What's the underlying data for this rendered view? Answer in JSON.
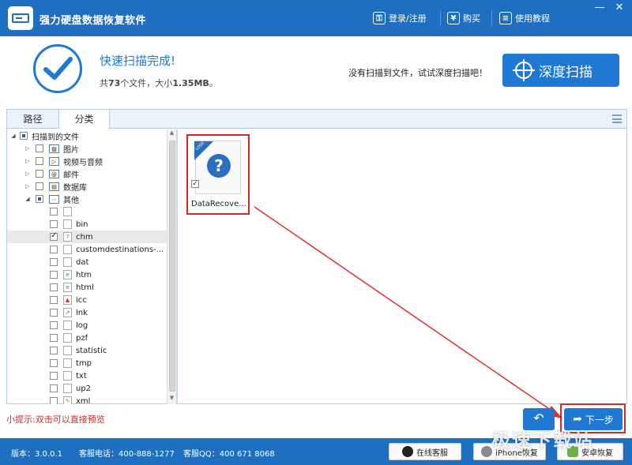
{
  "app": {
    "title": "强力硬盘数据恢复软件",
    "window_controls": {
      "minimize": "—",
      "close": "✕"
    }
  },
  "header_links": [
    {
      "label": "登录/注册",
      "icon": "login-icon"
    },
    {
      "label": "购买",
      "icon": "yen-icon"
    },
    {
      "label": "使用教程",
      "icon": "tutorial-icon"
    }
  ],
  "status": {
    "title": "快速扫描完成!",
    "summary_prefix": "共",
    "file_count": "73",
    "summary_middle": "个文件，大小",
    "total_size": "1.35MB",
    "summary_suffix": "。",
    "deep_hint": "没有扫描到文件，试试深度扫描吧！",
    "deep_scan_label": "深度扫描"
  },
  "tabs": [
    {
      "label": "路径",
      "active": false
    },
    {
      "label": "分类",
      "active": true
    }
  ],
  "tree": {
    "root": {
      "label": "扫描到的文件",
      "state": "partial"
    },
    "categories": [
      {
        "label": "图片",
        "icon": "image-icon",
        "state": "unchecked"
      },
      {
        "label": "视频与音频",
        "icon": "video-icon",
        "state": "unchecked"
      },
      {
        "label": "邮件",
        "icon": "mail-icon",
        "state": "unchecked"
      },
      {
        "label": "数据库",
        "icon": "database-icon",
        "state": "unchecked"
      },
      {
        "label": "其他",
        "icon": "other-icon",
        "state": "partial"
      }
    ],
    "types": [
      {
        "label": "",
        "state": "unchecked"
      },
      {
        "label": "bin",
        "state": "unchecked"
      },
      {
        "label": "chm",
        "state": "checked",
        "selected": true
      },
      {
        "label": "customdestinations-...",
        "state": "unchecked"
      },
      {
        "label": "dat",
        "state": "unchecked"
      },
      {
        "label": "htm",
        "state": "unchecked"
      },
      {
        "label": "html",
        "state": "unchecked"
      },
      {
        "label": "icc",
        "state": "unchecked"
      },
      {
        "label": "lnk",
        "state": "unchecked"
      },
      {
        "label": "log",
        "state": "unchecked"
      },
      {
        "label": "pzf",
        "state": "unchecked"
      },
      {
        "label": "statistic",
        "state": "unchecked"
      },
      {
        "label": "tmp",
        "state": "unchecked"
      },
      {
        "label": "txt",
        "state": "unchecked"
      },
      {
        "label": "up2",
        "state": "unchecked"
      },
      {
        "label": "xml",
        "state": "unchecked"
      }
    ]
  },
  "files": [
    {
      "name": "DataRecove...",
      "badge": "LOSE",
      "checked": true
    }
  ],
  "hint": "小提示:双击可以直接预览",
  "buttons": {
    "back_icon": "↶",
    "next_icon": "➦",
    "next": "下一步"
  },
  "footer": {
    "version": "版本：3.0.0.1",
    "phone": "客服电话：400-888-1277",
    "qq": "客服QQ：400 671 8068",
    "online_service": "在线客服",
    "iphone_recovery": "iPhone恢复",
    "android_recovery": "安卓恢复"
  },
  "watermark": "极速下载站",
  "colors": {
    "brand": "#1e6fc0",
    "accent": "#1f78d1",
    "highlight": "#d32a2a"
  }
}
